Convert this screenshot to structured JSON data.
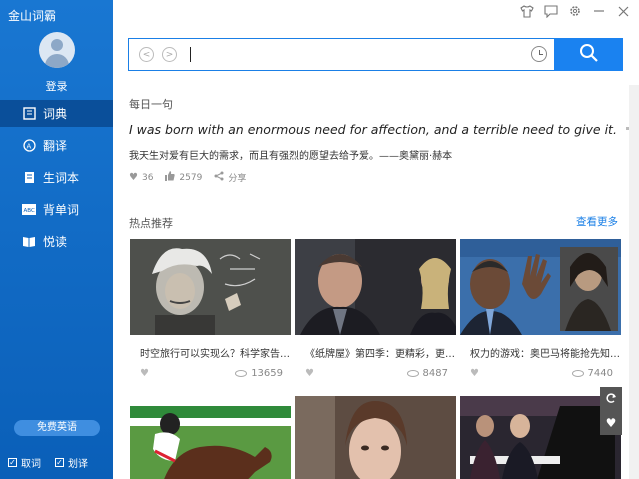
{
  "app": {
    "title": "金山词霸"
  },
  "sidebar": {
    "login": "登录",
    "items": [
      {
        "label": "词典",
        "icon": "book-icon"
      },
      {
        "label": "翻译",
        "icon": "translate-icon"
      },
      {
        "label": "生词本",
        "icon": "notebook-icon"
      },
      {
        "label": "背单词",
        "icon": "abc-card-icon"
      },
      {
        "label": "悦读",
        "icon": "open-book-icon"
      }
    ],
    "free_english": "免费英语",
    "options": [
      {
        "label": "取词",
        "checked": true
      },
      {
        "label": "划译",
        "checked": true
      }
    ]
  },
  "window_controls": [
    "shirt-skin-icon",
    "feedback-icon",
    "settings-gear-icon",
    "minimize-icon",
    "close-icon"
  ],
  "search": {
    "value": "",
    "placeholder": ""
  },
  "daily": {
    "title": "每日一句",
    "english": "I was born with an enormous need for affection, and a terrible need to give it.",
    "chinese": "我天生对爱有巨大的需求，而且有强烈的愿望去给予爱。——奥黛丽·赫本",
    "likes": "36",
    "thumbs": "2579",
    "share": "分享"
  },
  "hot": {
    "title": "热点推荐",
    "see_more": "查看更多",
    "cards": [
      {
        "caption": "时空旅行可以实现么？科学家告…",
        "views": "13659"
      },
      {
        "caption": "《纸牌屋》第四季：更精彩，更…",
        "views": "8487"
      },
      {
        "caption": "权力的游戏：奥巴马将能抢先知…",
        "views": "7440"
      }
    ]
  },
  "colors": {
    "sidebar": "#1977d2",
    "accent": "#1a82f0",
    "active_nav": "#0a4f9a"
  }
}
